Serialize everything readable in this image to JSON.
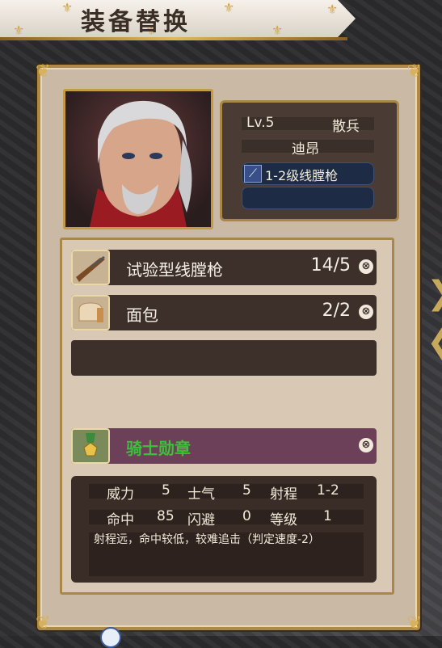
{
  "title": "装备替换",
  "character": {
    "level": "Lv.5",
    "class": "散兵",
    "name": "迪昂",
    "weapon": "1-2级线膛枪",
    "portrait_icon": "character-portrait-icon"
  },
  "items": [
    {
      "name": "试验型线膛枪",
      "qty": "14/5",
      "icon": "rifle-icon"
    },
    {
      "name": "面包",
      "qty": "2/2",
      "icon": "bread-icon"
    }
  ],
  "accessory": {
    "name": "骑士勋章",
    "icon": "medal-icon",
    "color": "#3fbf3a"
  },
  "stats": {
    "power_label": "威力",
    "power": "5",
    "morale_label": "士气",
    "morale": "5",
    "range_label": "射程",
    "range": "1-2",
    "hit_label": "命中",
    "hit": "85",
    "evade_label": "闪避",
    "evade": "0",
    "rank_label": "等级",
    "rank": "1",
    "description": "射程远，命中较低，较难追击（判定速度-2）"
  },
  "remove_symbol": "⊗"
}
